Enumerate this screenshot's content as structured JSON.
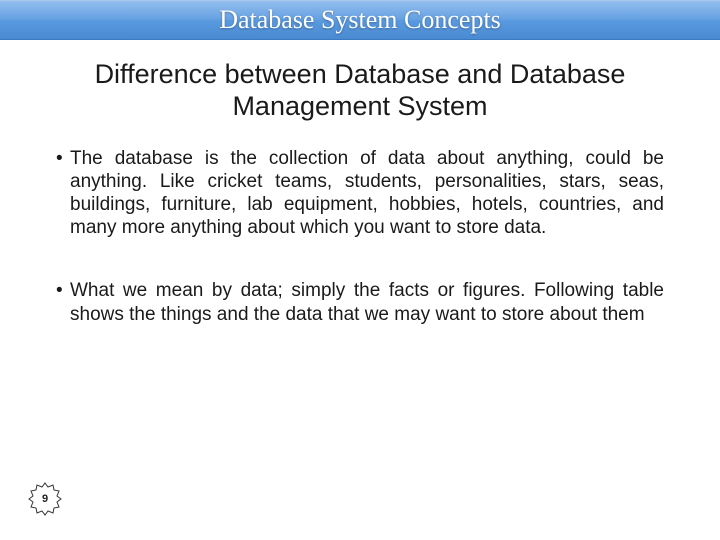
{
  "header": {
    "title": "Database System Concepts"
  },
  "slide": {
    "title": "Difference between Database and Database Management System",
    "bullets": [
      "The database is the collection of data about anything, could be anything. Like cricket teams, students, personalities, stars, seas, buildings, furniture, lab equipment, hobbies, hotels, countries, and many more anything about which you want to store data.",
      "What we mean by data; simply the facts or figures. Following table shows the things and the data that we may want to store about them"
    ]
  },
  "page": {
    "number": "9"
  }
}
